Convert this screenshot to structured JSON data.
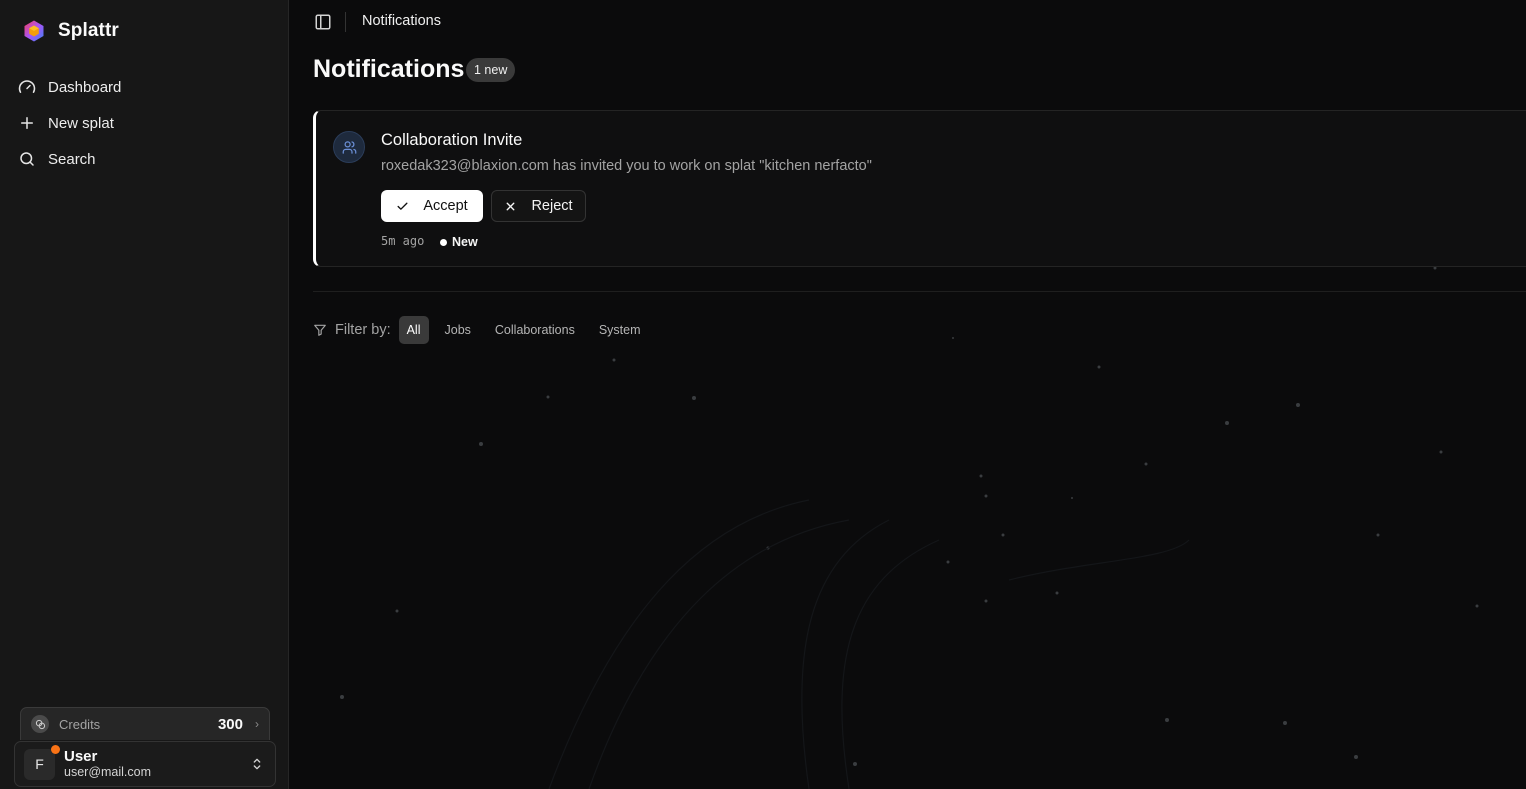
{
  "app": {
    "name": "Splattr",
    "logo_icon": "hexagon-logo-icon"
  },
  "sidebar": {
    "items": [
      {
        "label": "Dashboard",
        "icon": "gauge-icon"
      },
      {
        "label": "New splat",
        "icon": "plus-icon"
      },
      {
        "label": "Search",
        "icon": "search-icon"
      }
    ],
    "credits": {
      "label": "Credits",
      "value": "300",
      "icon": "coins-icon"
    },
    "user": {
      "initial": "F",
      "name": "User",
      "email": "user@mail.com",
      "status_color": "#f97316"
    }
  },
  "topbar": {
    "breadcrumb": "Notifications",
    "toggle_icon": "sidebar-toggle-icon"
  },
  "page": {
    "title": "Notifications",
    "badge": "1 new"
  },
  "notification": {
    "icon": "users-icon",
    "title": "Collaboration Invite",
    "body": "roxedak323@blaxion.com has invited you to work on splat \"kitchen nerfacto\"",
    "accept_label": "Accept",
    "reject_label": "Reject",
    "time": "5m ago",
    "status": "New"
  },
  "filters": {
    "label": "Filter by:",
    "options": [
      "All",
      "Jobs",
      "Collaborations",
      "System"
    ],
    "active": "All"
  },
  "colors": {
    "background": "#0b0b0c",
    "sidebar": "#171717",
    "accent": "#ffffff",
    "notif_icon_bg": "#1e2a3d",
    "notif_icon_fg": "#6b8fd6"
  }
}
